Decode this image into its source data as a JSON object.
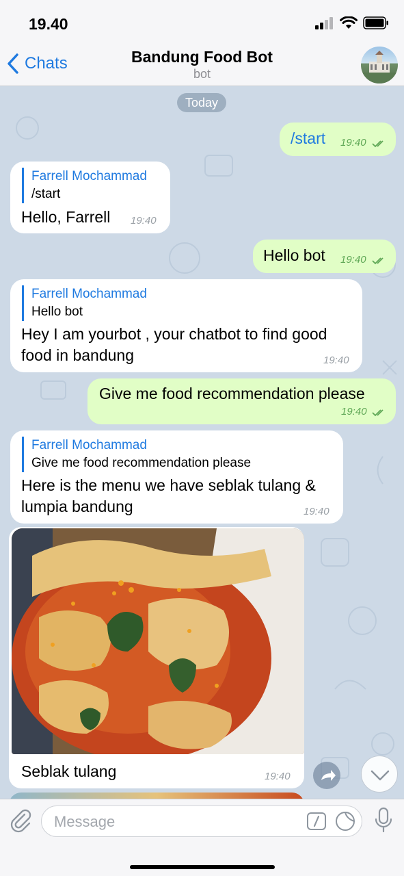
{
  "status": {
    "time": "19.40"
  },
  "header": {
    "back_label": "Chats",
    "title": "Bandung Food Bot",
    "subtitle": "bot"
  },
  "chat": {
    "date_label": "Today",
    "messages": [
      {
        "text": "/start",
        "time": "19:40"
      },
      {
        "reply_name": "Farrell Mochammad",
        "reply_text": "/start",
        "text": "Hello, Farrell",
        "time": "19:40"
      },
      {
        "text": "Hello bot",
        "time": "19:40"
      },
      {
        "reply_name": "Farrell Mochammad",
        "reply_text": "Hello bot",
        "line1": "Hey I am yourbot , your chatbot to find good",
        "line2": "food in bandung",
        "time": "19:40"
      },
      {
        "text": "Give me food recommendation please",
        "time": "19:40"
      },
      {
        "reply_name": "Farrell Mochammad",
        "reply_text": "Give me food recommendation please",
        "line1": "Here is the menu we have seblak tulang &",
        "line2": "lumpia bandung",
        "time": "19:40"
      },
      {
        "caption": "Seblak tulang",
        "time": "19:40"
      }
    ]
  },
  "input": {
    "placeholder": "Message"
  },
  "colors": {
    "accent": "#1f7ae0",
    "outgoing_bubble": "#e1fec6",
    "incoming_bubble": "#ffffff",
    "chat_bg": "#cdd9e6"
  },
  "icons": [
    "back-chevron-icon",
    "signal-icon",
    "wifi-icon",
    "battery-icon",
    "attach-icon",
    "command-icon",
    "sticker-icon",
    "microphone-icon",
    "share-icon",
    "scroll-down-icon",
    "read-check-icon"
  ]
}
